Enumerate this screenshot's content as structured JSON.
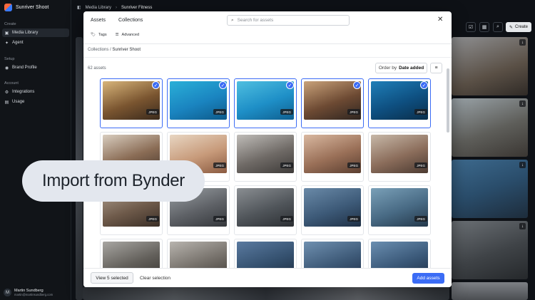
{
  "sidebar": {
    "brand": "Sunriver Shoot",
    "sections": {
      "create": "Create",
      "setup": "Setup",
      "account": "Account"
    },
    "items": [
      {
        "label": "Media Library",
        "icon": "image-icon"
      },
      {
        "label": "Agent",
        "icon": "sparkle-icon"
      },
      {
        "label": "Brand Profile",
        "icon": "brand-icon"
      },
      {
        "label": "Integrations",
        "icon": "integrations-icon"
      },
      {
        "label": "Usage",
        "icon": "usage-icon"
      }
    ],
    "user": {
      "initials": "M",
      "name": "Martin Sundberg",
      "email": "martin@martinsundberg.com"
    }
  },
  "topbar": {
    "breadcrumb": [
      "Media Library",
      "Sunriver Fitness"
    ],
    "create_label": "Create"
  },
  "modal": {
    "tabs": [
      "Assets",
      "Collections"
    ],
    "search_placeholder": "Search for assets",
    "filters": {
      "tags": "Tags",
      "advanced": "Advanced"
    },
    "breadcrumb_root": "Collections",
    "breadcrumb_sep": "/",
    "breadcrumb_current": "Sunriver Shoot",
    "count": "62 assets",
    "order_prefix": "Order by",
    "order_value": "Date added",
    "badge": "JPEG",
    "view_selected": "View 5 selected",
    "clear_selection": "Clear selection",
    "add_assets": "Add assets"
  },
  "overlay": {
    "text": "Import from Bynder"
  },
  "colors": {
    "accent": "#3b6cf5",
    "sidebar_bg": "#111418",
    "modal_bg": "#ffffff"
  }
}
